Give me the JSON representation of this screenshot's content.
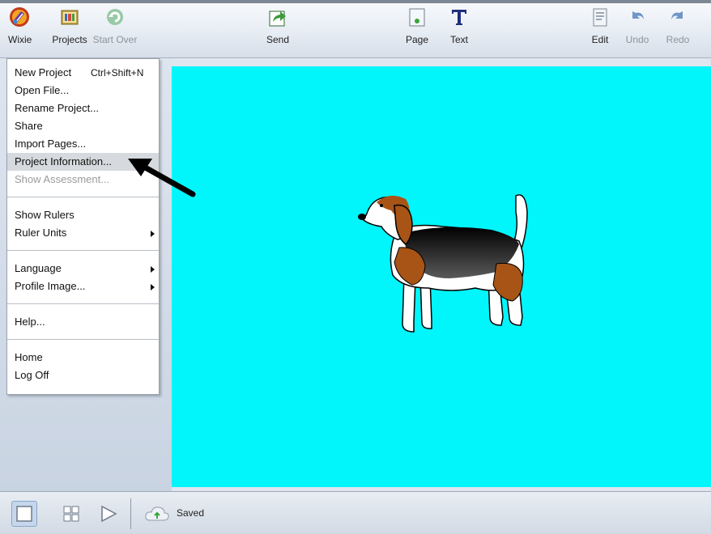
{
  "toolbar": {
    "wixie": "Wixie",
    "projects": "Projects",
    "start_over": "Start Over",
    "send": "Send",
    "page": "Page",
    "text": "Text",
    "edit": "Edit",
    "undo": "Undo",
    "redo": "Redo"
  },
  "menu": {
    "new_project": "New Project",
    "new_project_shortcut": "Ctrl+Shift+N",
    "open_file": "Open File...",
    "rename_project": "Rename Project...",
    "share": "Share",
    "import_pages": "Import Pages...",
    "project_information": "Project Information...",
    "show_assessment": "Show Assessment...",
    "show_rulers": "Show Rulers",
    "ruler_units": "Ruler Units",
    "language": "Language",
    "profile_image": "Profile Image...",
    "help": "Help...",
    "home": "Home",
    "log_off": "Log Off"
  },
  "canvas": {
    "background": "#00f6fb"
  },
  "status": {
    "saved": "Saved"
  },
  "icons": {
    "wixie": "wixie-logo-icon",
    "projects": "projects-folder-icon",
    "start_over": "refresh-icon",
    "send": "send-share-icon",
    "page": "add-page-icon",
    "text": "text-t-icon",
    "edit": "edit-document-icon",
    "undo": "undo-icon",
    "redo": "redo-icon",
    "single_page": "single-page-view-icon",
    "grid": "grid-view-icon",
    "play": "play-icon",
    "cloud": "cloud-upload-icon"
  }
}
